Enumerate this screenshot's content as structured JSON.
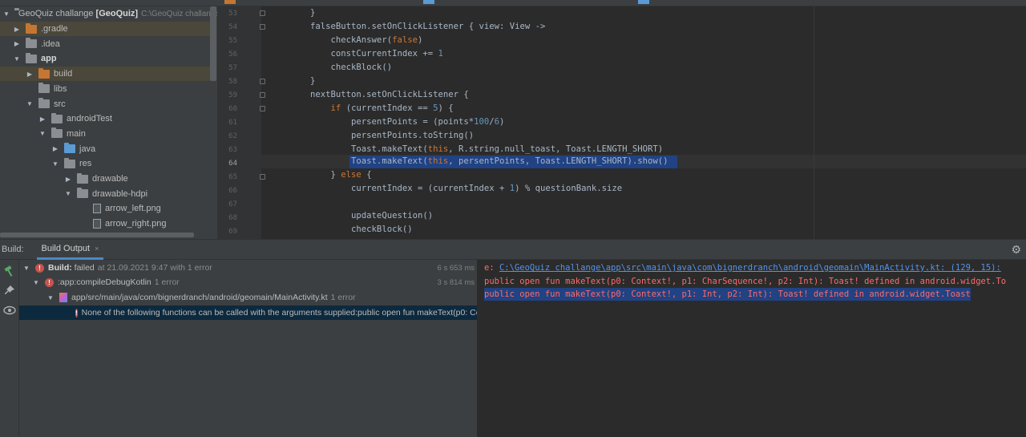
{
  "colors": {
    "accent": "#4a88c7",
    "selection": "#214283",
    "error": "#c75450",
    "keyword": "#cc7832",
    "number": "#6897bb",
    "console_error": "#ff6b68",
    "link": "#5394ec"
  },
  "project_tree": {
    "items": [
      {
        "label": "GeoQuiz challange",
        "bold": "[GeoQuiz]",
        "path": "C:\\GeoQuiz challange"
      },
      {
        "label": ".gradle"
      },
      {
        "label": ".idea"
      },
      {
        "label": "app"
      },
      {
        "label": "build"
      },
      {
        "label": "libs"
      },
      {
        "label": "src"
      },
      {
        "label": "androidTest"
      },
      {
        "label": "main"
      },
      {
        "label": "java"
      },
      {
        "label": "res"
      },
      {
        "label": "drawable"
      },
      {
        "label": "drawable-hdpi"
      },
      {
        "label": "arrow_left.png"
      },
      {
        "label": "arrow_right.png"
      }
    ]
  },
  "editor": {
    "line_numbers": [
      "53",
      "54",
      "55",
      "56",
      "57",
      "58",
      "59",
      "60",
      "61",
      "62",
      "63",
      "64",
      "65",
      "66",
      "67",
      "68",
      "69"
    ],
    "current_line": "64"
  },
  "build": {
    "panel_title": "Build:",
    "tab_label": "Build Output",
    "tab_close": "×",
    "rows": [
      {
        "prefix": "Build:",
        "text": "failed",
        "detail": "at 21.09.2021 9:47 with 1 error",
        "time": "6 s 653 ms"
      },
      {
        "text": ":app:compileDebugKotlin",
        "detail": "1 error",
        "time": "3 s 814 ms"
      },
      {
        "text": "app/src/main/java/com/bignerdranch/android/geomain/MainActivity.kt",
        "detail": "1 error"
      },
      {
        "text": "None of the following functions can be called with the arguments supplied:public open fun makeText(p0: Co"
      }
    ]
  },
  "console": {
    "prefix": "e:",
    "link": "C:\\GeoQuiz challange\\app\\src\\main\\java\\com\\bignerdranch\\android\\geomain\\MainActivity.kt: (129, 15):",
    "line2": "public open fun makeText(p0: Context!, p1: CharSequence!, p2: Int): Toast! defined in android.widget.To",
    "line3": "public open fun makeText(p0: Context!, p1: Int, p2: Int): Toast! defined in android.widget.Toast"
  },
  "icons": {
    "gear": "gear-icon",
    "hammer": "hammer-icon",
    "pin": "pin-icon",
    "eye": "eye-icon"
  }
}
